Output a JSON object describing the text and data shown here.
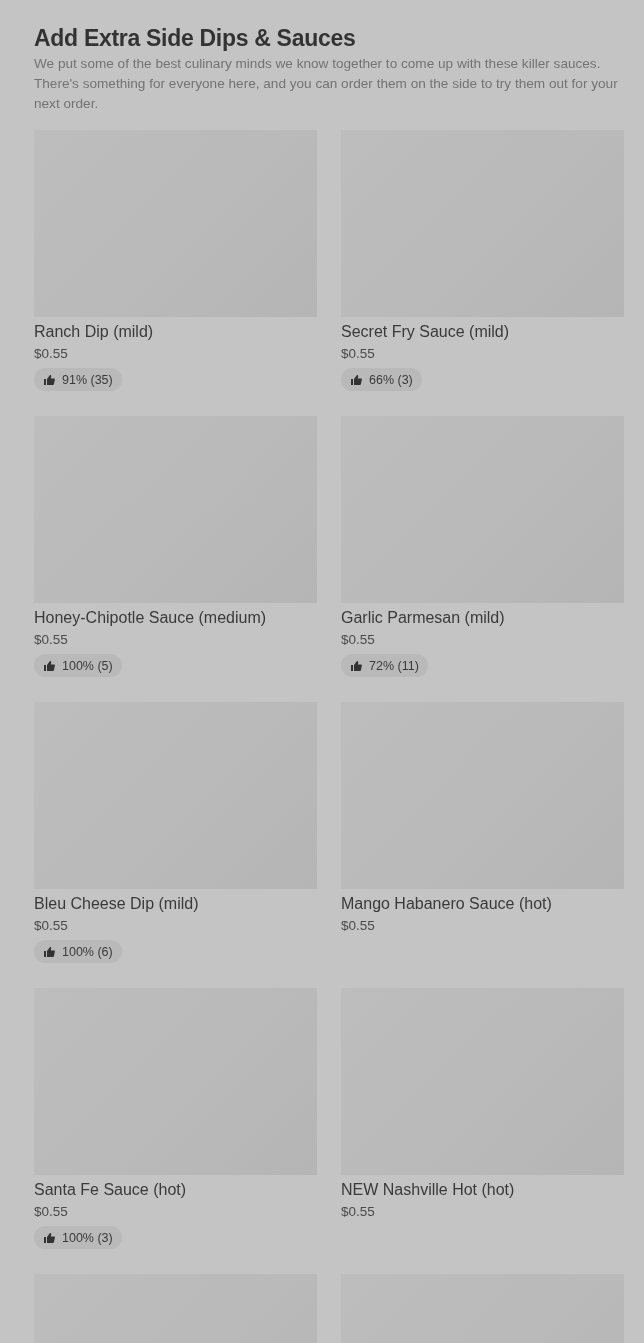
{
  "section": {
    "title": "Add Extra Side Dips & Sauces",
    "description": "We put some of the best culinary minds we know together to come up with these killer sauces. There's something for everyone here, and you can order them on the side to try them out for your next order."
  },
  "items": [
    {
      "kind": "full",
      "name": "Ranch Dip (mild)",
      "price": "$0.55",
      "rating": "91% (35)"
    },
    {
      "kind": "full",
      "name": "Secret Fry Sauce (mild)",
      "price": "$0.55",
      "rating": "66% (3)"
    },
    {
      "kind": "full",
      "name": "Honey-Chipotle Sauce (medium)",
      "price": "$0.55",
      "rating": "100% (5)"
    },
    {
      "kind": "full",
      "name": "Garlic Parmesan (mild)",
      "price": "$0.55",
      "rating": "72% (11)"
    },
    {
      "kind": "full",
      "name": "Bleu Cheese Dip (mild)",
      "price": "$0.55",
      "rating": "100% (6)"
    },
    {
      "kind": "full",
      "name": "Mango Habanero Sauce (hot)",
      "price": "$0.55"
    },
    {
      "kind": "full",
      "name": "Santa Fe Sauce (hot)",
      "price": "$0.55",
      "rating": "100% (3)"
    },
    {
      "kind": "full",
      "name": "NEW Nashville Hot (hot)",
      "price": "$0.55"
    },
    {
      "kind": "cut"
    },
    {
      "kind": "cut"
    }
  ]
}
